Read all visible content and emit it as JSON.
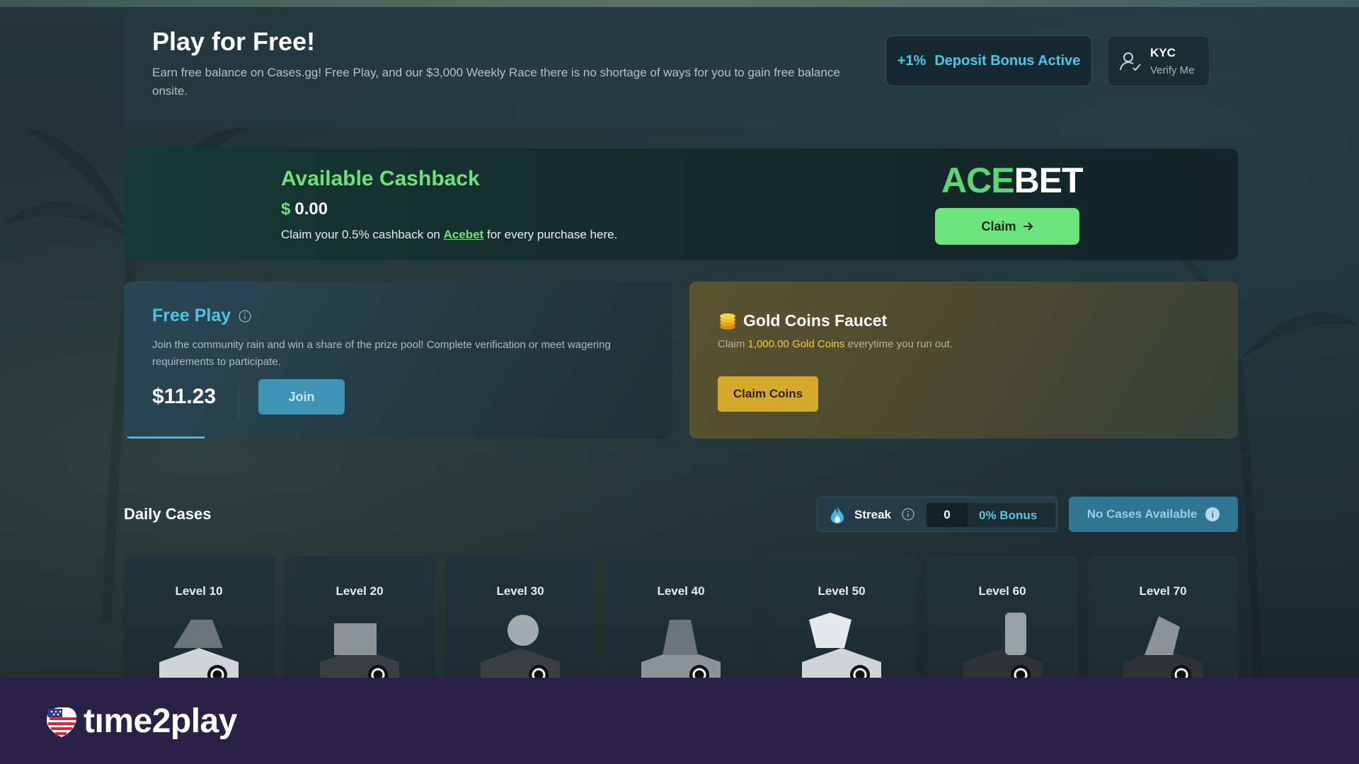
{
  "header": {
    "title": "Play for Free!",
    "description": "Earn free balance on Cases.gg! Free Play, and our $3,000 Weekly Race there is no shortage of ways for you to gain free balance onsite.",
    "bonus_percent": "+1%",
    "bonus_label": "Deposit Bonus Active",
    "kyc_title": "KYC",
    "kyc_subtitle": "Verify Me"
  },
  "cashback": {
    "title": "Available Cashback",
    "currency": "$",
    "amount": "0.00",
    "desc_prefix": "Claim your 0.5% cashback on",
    "desc_link": "Acebet",
    "desc_suffix": "for every purchase here.",
    "logo_ace": "ACE",
    "logo_bet": "BET",
    "claim_label": "Claim"
  },
  "free_play": {
    "title": "Free Play",
    "description": "Join the community rain and win a share of the prize pool! Complete verification or meet wagering requirements to participate.",
    "amount": "$11.23",
    "join_label": "Join"
  },
  "faucet": {
    "title": "Gold Coins Faucet",
    "desc_prefix": "Claim",
    "desc_highlight": "1,000.00 Gold Coins",
    "desc_suffix": "everytime you run out.",
    "button_label": "Claim Coins"
  },
  "daily": {
    "title": "Daily Cases",
    "streak_label": "Streak",
    "streak_count": "0",
    "streak_bonus": "0% Bonus",
    "no_cases_label": "No Cases Available",
    "no_cases_icon": "i",
    "cases": [
      {
        "label": "Level 10"
      },
      {
        "label": "Level 20"
      },
      {
        "label": "Level 30"
      },
      {
        "label": "Level 40"
      },
      {
        "label": "Level 50"
      },
      {
        "label": "Level 60"
      },
      {
        "label": "Level 70"
      }
    ]
  },
  "footer": {
    "brand": "tıme2play"
  },
  "colors": {
    "accent_green": "#6ee07d",
    "accent_blue": "#48c6e4",
    "gold": "#d4a92c",
    "footer_bg": "#2a2147"
  }
}
